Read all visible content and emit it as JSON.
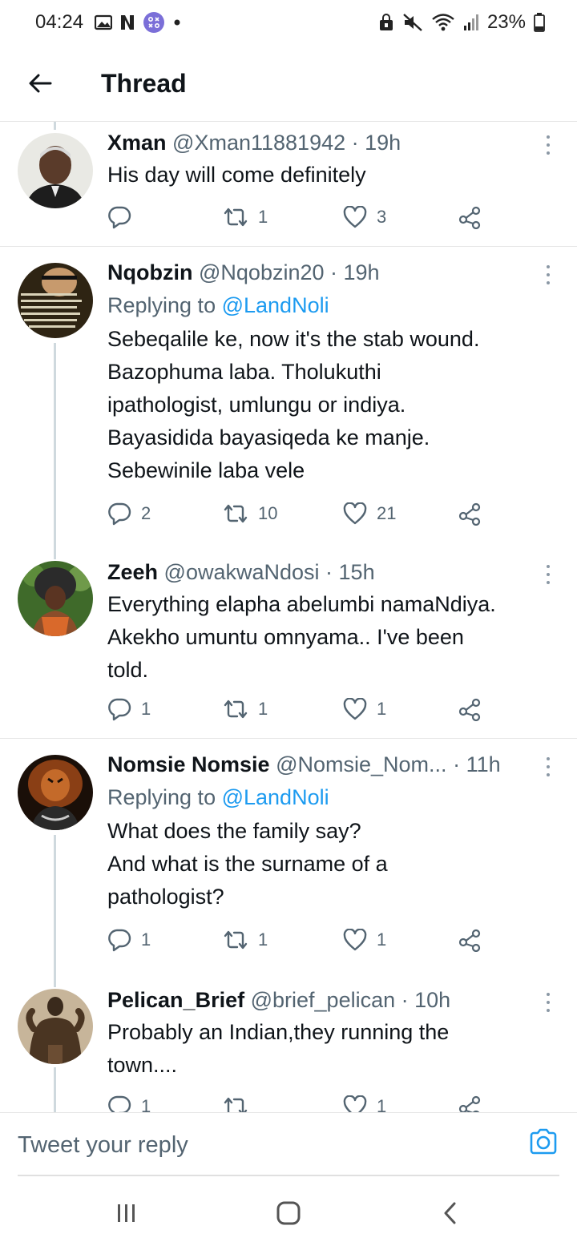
{
  "status_bar": {
    "time": "04:24",
    "battery": "23%"
  },
  "header": {
    "title": "Thread"
  },
  "colors": {
    "link": "#1d9bf0",
    "secondary_text": "#536471",
    "primary_text": "#0f1419"
  },
  "tweets": [
    {
      "name": "Xman",
      "handle": "@Xman11881942",
      "time": "· 19h",
      "replying_prefix": "",
      "replying_to": "",
      "lines": [
        "His day will come definitely"
      ],
      "replies": "",
      "retweets": "1",
      "likes": "3"
    },
    {
      "name": "Nqobzin",
      "handle": "@Nqobzin20",
      "time": "· 19h",
      "replying_prefix": "Replying to ",
      "replying_to": "@LandNoli",
      "lines": [
        "Sebeqalile ke, now it's the stab wound.",
        "Bazophuma laba. Tholukuthi",
        "ipathologist, umlungu or indiya.",
        "Bayasidida bayasiqeda ke manje.",
        "Sebewinile laba vele"
      ],
      "replies": "2",
      "retweets": "10",
      "likes": "21"
    },
    {
      "name": "Zeeh",
      "handle": "@owakwaNdosi",
      "time": "· 15h",
      "replying_prefix": "",
      "replying_to": "",
      "lines": [
        "Everything elapha abelumbi namaNdiya.",
        "Akekho umuntu omnyama.. I've been",
        "told."
      ],
      "replies": "1",
      "retweets": "1",
      "likes": "1"
    },
    {
      "name": "Nomsie Nomsie",
      "handle": "@Nomsie_Nom...",
      "time": "· 11h",
      "replying_prefix": "Replying to ",
      "replying_to": "@LandNoli",
      "lines": [
        "What does the family say?",
        "And what is the surname of a",
        "pathologist?"
      ],
      "replies": "1",
      "retweets": "1",
      "likes": "1"
    },
    {
      "name": "Pelican_Brief",
      "handle": "@brief_pelican",
      "time": "· 10h",
      "replying_prefix": "",
      "replying_to": "",
      "lines": [
        "Probably an Indian,they running the",
        "town...."
      ],
      "replies": "1",
      "retweets": "",
      "likes": "1"
    }
  ],
  "reply_bar": {
    "placeholder": "Tweet your reply"
  },
  "icons": {
    "back": "arrow-left-icon",
    "more": "more-vertical-icon",
    "reply": "reply-icon",
    "retweet": "retweet-icon",
    "like": "heart-icon",
    "share": "share-icon",
    "camera": "camera-icon"
  }
}
